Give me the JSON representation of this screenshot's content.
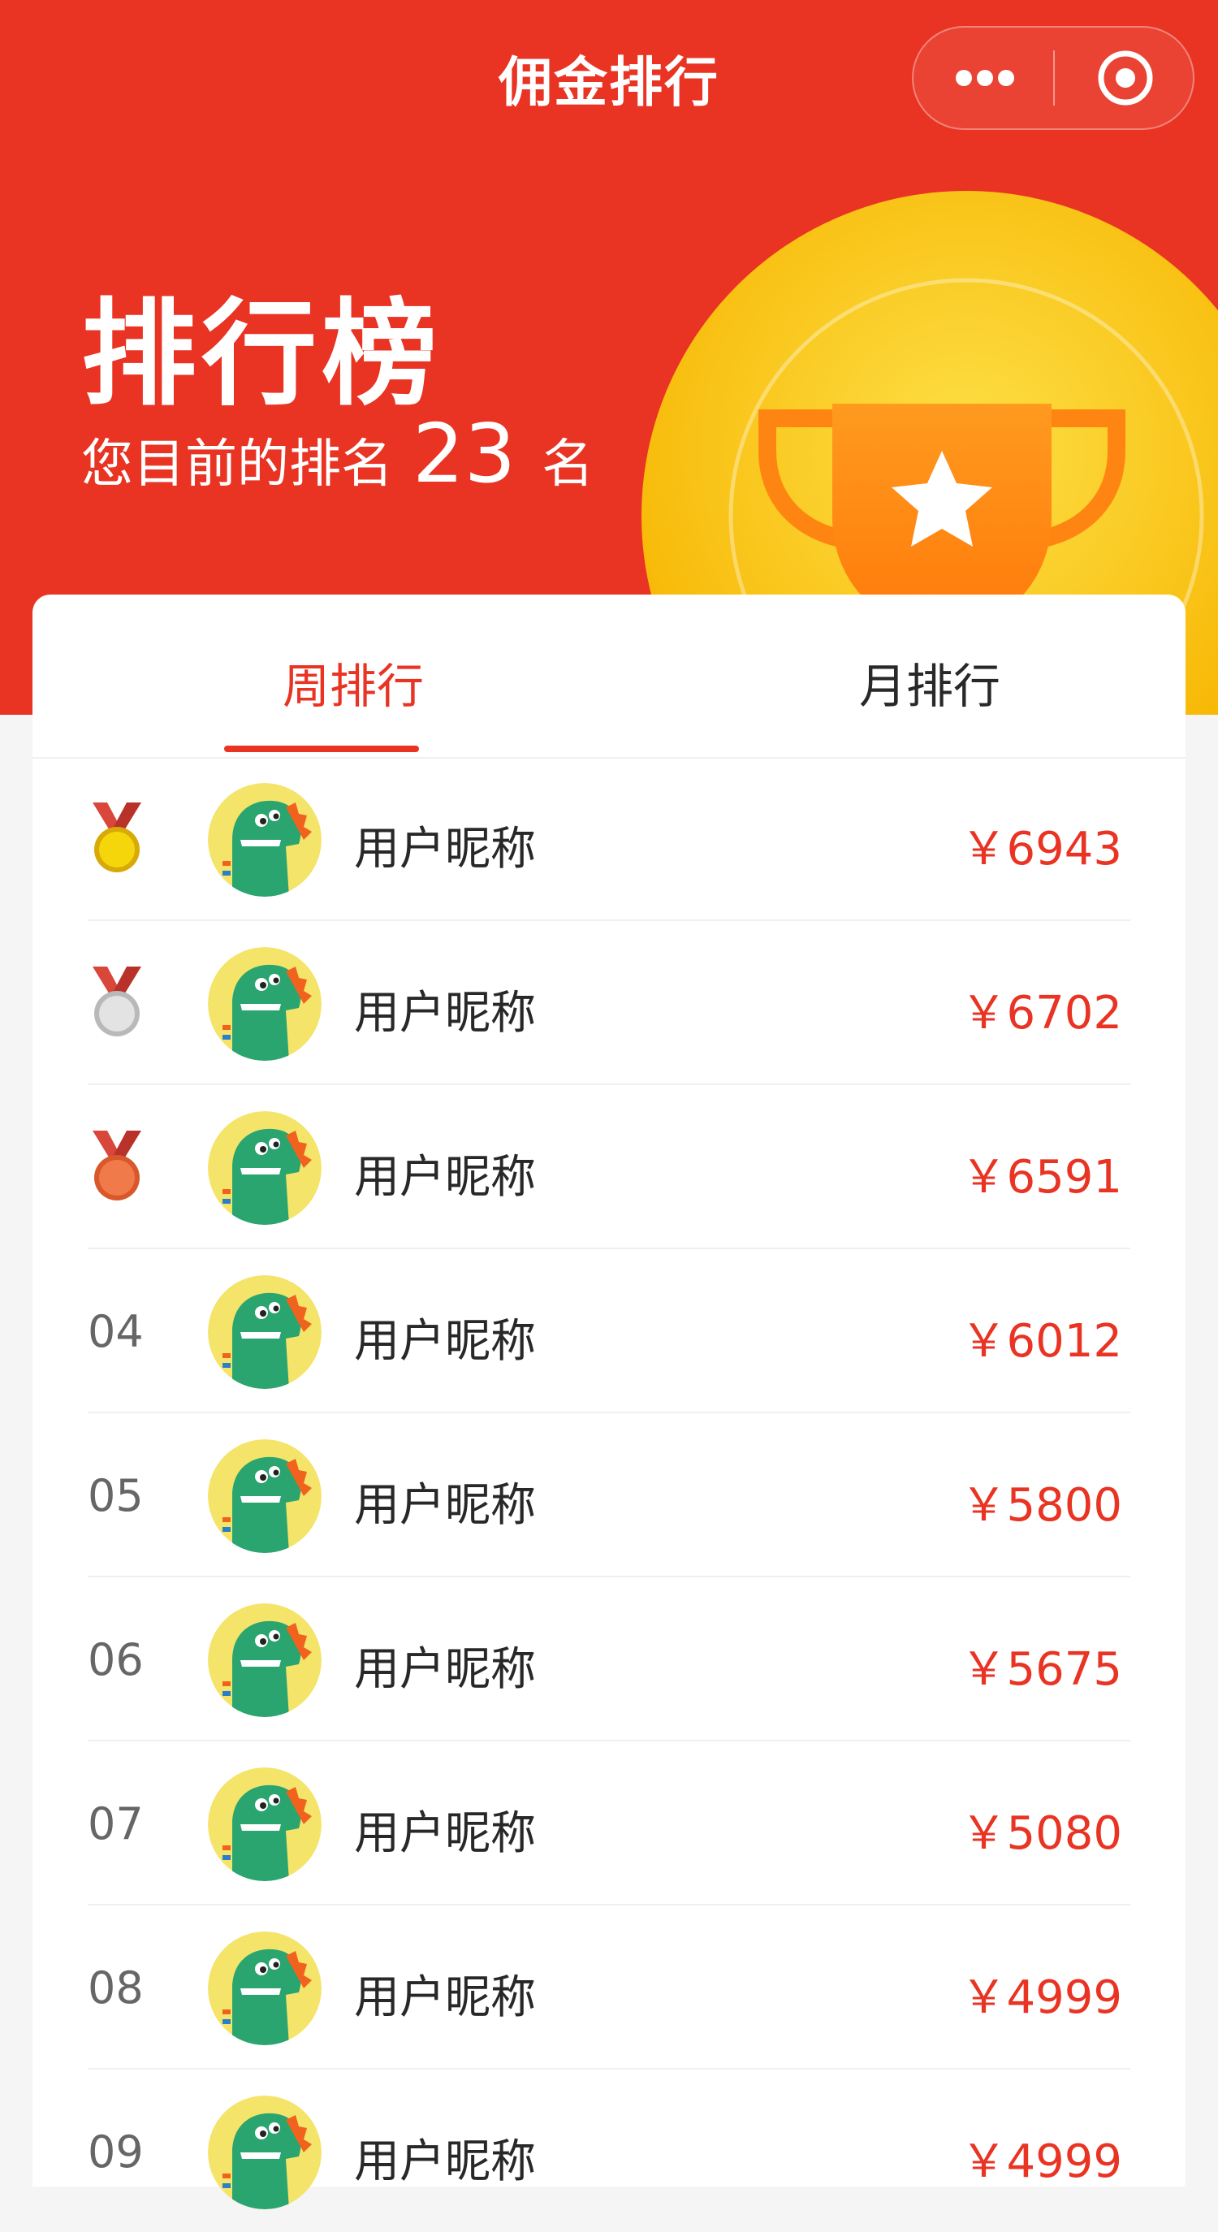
{
  "nav": {
    "title": "佣金排行"
  },
  "banner": {
    "title": "排行榜",
    "rank_prefix": "您目前的排名",
    "rank_value": "23",
    "rank_suffix": "名"
  },
  "tabs": [
    {
      "label": "周排行",
      "active": true
    },
    {
      "label": "月排行",
      "active": false
    }
  ],
  "colors": {
    "accent": "#e93323",
    "gold": "#f7c10b"
  },
  "ranking": [
    {
      "rank": "01",
      "medal": "gold-medal-icon",
      "name": "用户昵称",
      "amount": "￥6943"
    },
    {
      "rank": "02",
      "medal": "silver-medal-icon",
      "name": "用户昵称",
      "amount": "￥6702"
    },
    {
      "rank": "03",
      "medal": "bronze-medal-icon",
      "name": "用户昵称",
      "amount": "￥6591"
    },
    {
      "rank": "04",
      "name": "用户昵称",
      "amount": "￥6012"
    },
    {
      "rank": "05",
      "name": "用户昵称",
      "amount": "￥5800"
    },
    {
      "rank": "06",
      "name": "用户昵称",
      "amount": "￥5675"
    },
    {
      "rank": "07",
      "name": "用户昵称",
      "amount": "￥5080"
    },
    {
      "rank": "08",
      "name": "用户昵称",
      "amount": "￥4999"
    },
    {
      "rank": "09",
      "name": "用户昵称",
      "amount": "￥4999"
    }
  ]
}
